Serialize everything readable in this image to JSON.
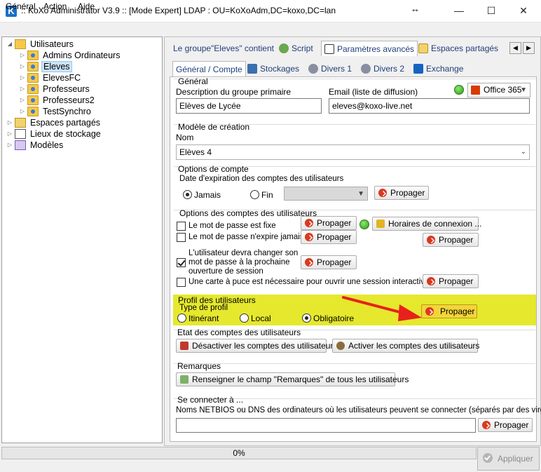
{
  "window": {
    "title": ":: KoXo Administrator V3.9 :: [Mode Expert] LDAP : OU=KoXoAdm,DC=koxo,DC=lan",
    "logo": "K",
    "min_glyph": "—",
    "max_glyph": "☐",
    "close_glyph": "✕",
    "resize_glyph": "↔"
  },
  "menu": [
    "Général",
    "Action",
    "Aide"
  ],
  "tree": {
    "root": "Utilisateurs",
    "children": [
      "Admins Ordinateurs",
      "Eleves",
      "ElevesFC",
      "Professeurs",
      "Professeurs2",
      "TestSynchro"
    ],
    "selected": "Eleves",
    "others": [
      "Espaces partagés",
      "Lieux de stockage",
      "Modèles"
    ]
  },
  "tabs": {
    "top": [
      "Le groupe\"Eleves\" contient",
      "Script",
      "Paramètres avancés",
      "Espaces partagés"
    ],
    "active_top": "Paramètres avancés",
    "sub": [
      "Général / Compte",
      "Stockages",
      "Divers 1",
      "Divers 2",
      "Exchange"
    ],
    "active_sub": "Général / Compte"
  },
  "general": {
    "title": "Général",
    "desc_label": "Description du groupe primaire",
    "desc_value": "Elèves de Lycée",
    "email_label": "Email (liste de diffusion)",
    "email_value": "eleves@koxo-live.net",
    "office": "Office 365"
  },
  "modele": {
    "title": "Modèle de création",
    "nom_label": "Nom",
    "nom_value": "Elèves 4"
  },
  "options_compte": {
    "title": "Options de compte",
    "expiration_label": "Date d'expiration des comptes des utilisateurs",
    "jamais": "Jamais",
    "fin": "Fin",
    "propager": "Propager"
  },
  "options_users": {
    "title": "Options des comptes des utilisateurs",
    "pwd_fixe": "Le mot de passe est fixe",
    "pwd_never": "Le mot de passe n'expire jamais",
    "change_1": "L'utilisateur devra changer son",
    "change_2": "mot de passe à la prochaine",
    "change_3": "ouverture de session",
    "smartcard": "Une carte à puce est nécessaire pour ouvrir une session interactive",
    "horaires": "Horaires de connexion ..."
  },
  "profil": {
    "title": "Profil des utilisateurs",
    "type_label": "Type de profil",
    "itinerant": "Itinérant",
    "local": "Local",
    "obligatoire": "Obligatoire",
    "selected": "Obligatoire"
  },
  "etat": {
    "title": "Etat des comptes des utilisateurs",
    "desactiver": "Désactiver les comptes des utilisateurs",
    "activer": "Activer les comptes des utilisateurs"
  },
  "remarques": {
    "title": "Remarques",
    "button": "Renseigner le champ \"Remarques\" de tous les utilisateurs"
  },
  "connecter": {
    "title": "Se connecter à ...",
    "label": "Noms NETBIOS ou DNS des ordinateurs où les utilisateurs peuvent se connecter (séparés par des virgules)",
    "value": ""
  },
  "status": {
    "progress": 0,
    "progress_text": "0%",
    "apply": "Appliquer"
  },
  "colors": {
    "highlight": "#e5e82d",
    "arrow": "#e8211c",
    "tab_text": "#1f3f7a"
  }
}
